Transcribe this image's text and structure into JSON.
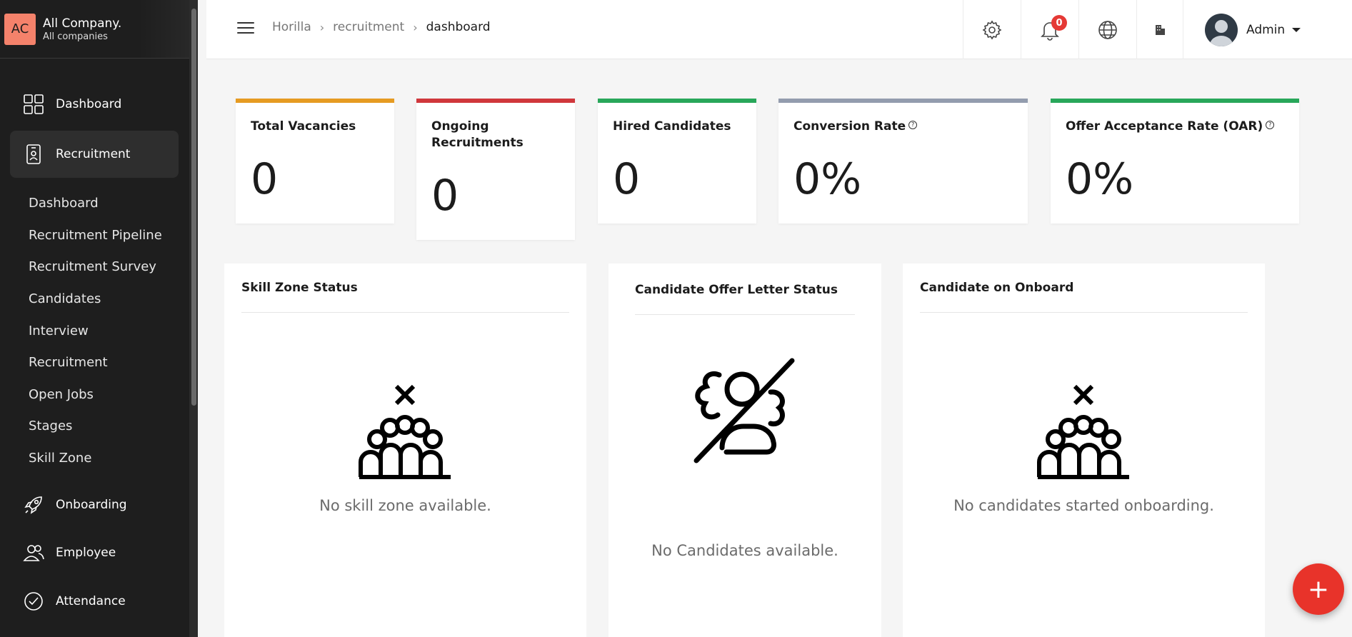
{
  "brand": {
    "initials": "AC",
    "company": "All Company.",
    "subtitle": "All companies"
  },
  "sidebar": {
    "items": [
      {
        "label": "Dashboard",
        "icon": "grid-icon"
      },
      {
        "label": "Recruitment",
        "icon": "id-badge-icon",
        "active": true
      },
      {
        "label": "Onboarding",
        "icon": "rocket-icon"
      },
      {
        "label": "Employee",
        "icon": "people-icon"
      },
      {
        "label": "Attendance",
        "icon": "check-circle-icon"
      }
    ],
    "subitems": [
      "Dashboard",
      "Recruitment Pipeline",
      "Recruitment Survey",
      "Candidates",
      "Interview",
      "Recruitment",
      "Open Jobs",
      "Stages",
      "Skill Zone"
    ]
  },
  "breadcrumb": [
    "Horilla",
    "recruitment",
    "dashboard"
  ],
  "topbar": {
    "notification_count": "0",
    "user_name": "Admin"
  },
  "kpis": [
    {
      "title": "Total Vacancies",
      "value": "0",
      "color": "#e69b22"
    },
    {
      "title": "Ongoing Recruitments",
      "value": "0",
      "color": "#d0373c"
    },
    {
      "title": "Hired Candidates",
      "value": "0",
      "color": "#28a75a"
    },
    {
      "title": "Conversion Rate",
      "value": "0%",
      "color": "#939cae"
    },
    {
      "title": "Offer Acceptance Rate (OAR)",
      "value": "0%",
      "color": "#28a75a"
    }
  ],
  "panels": {
    "skill_zone": {
      "title": "Skill Zone Status",
      "empty": "No skill zone available."
    },
    "offer_letter": {
      "title": "Candidate Offer Letter Status",
      "empty": "No Candidates available."
    },
    "onboard": {
      "title": "Candidate on Onboard",
      "empty": "No candidates started onboarding."
    }
  },
  "fab": {
    "label": "+"
  }
}
